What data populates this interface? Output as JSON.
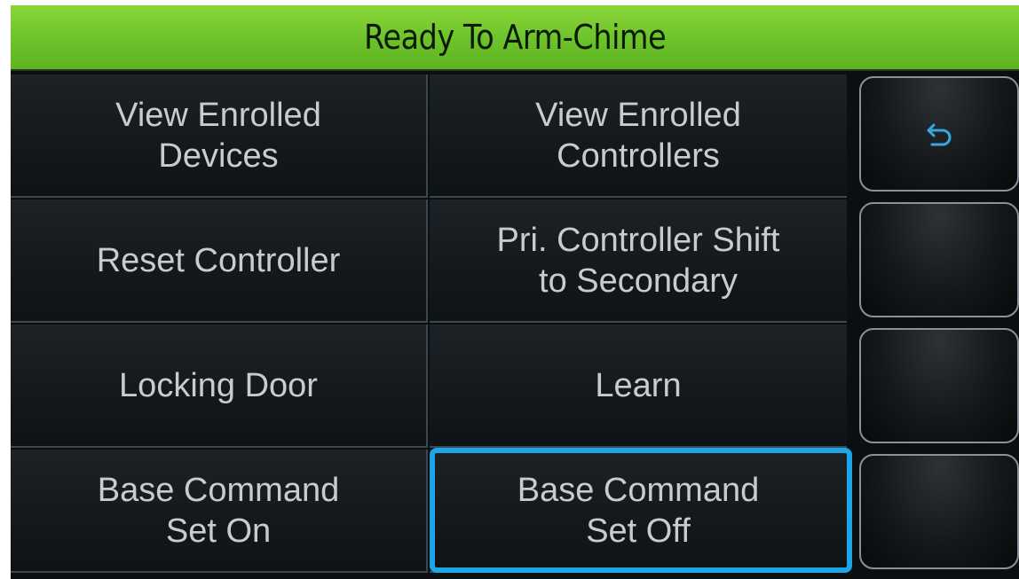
{
  "status_bar": {
    "title": "Ready To Arm-Chime",
    "color": "#6cc22a"
  },
  "menu": {
    "items": [
      {
        "label": "View Enrolled\nDevices"
      },
      {
        "label": "View Enrolled\nControllers"
      },
      {
        "label": "Reset Controller"
      },
      {
        "label": "Pri. Controller Shift\nto Secondary"
      },
      {
        "label": "Locking Door"
      },
      {
        "label": "Learn"
      },
      {
        "label": "Base Command\nSet On"
      },
      {
        "label": "Base Command\nSet Off"
      }
    ],
    "selected_index": 7,
    "highlight_color": "#1ca6e6"
  },
  "side_buttons": [
    {
      "icon": "back-arrow-icon"
    },
    {
      "icon": ""
    },
    {
      "icon": ""
    },
    {
      "icon": ""
    }
  ]
}
